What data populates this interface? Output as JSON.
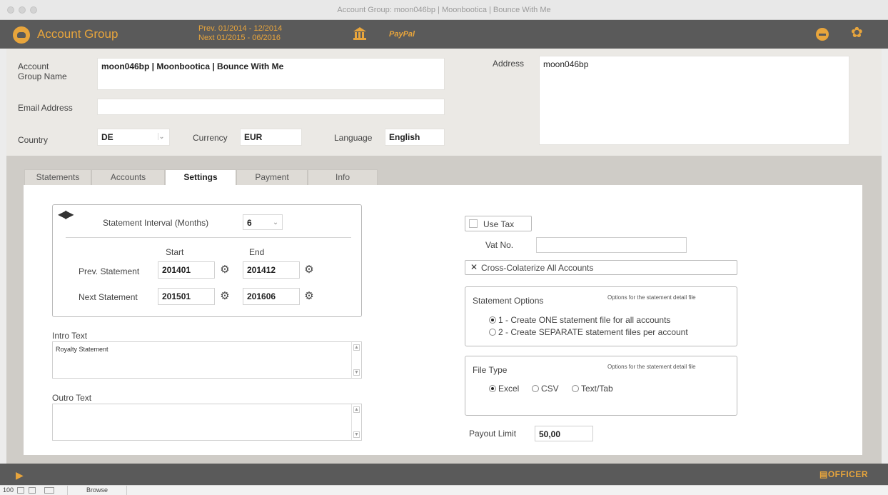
{
  "window": {
    "title": "Account Group: moon046bp | Moonbootica | Bounce With Me"
  },
  "header": {
    "title": "Account Group",
    "prev_period": "Prev. 01/2014 - 12/2014",
    "next_period": "Next  01/2015 - 06/2016",
    "paypal_label": "PayPal",
    "brand_color": "#e8a53c",
    "icons": [
      "account-group-icon",
      "bank-icon",
      "minus-circle-icon",
      "paw-icon"
    ]
  },
  "form": {
    "name_label": "Account Group Name",
    "name_value": "moon046bp | Moonbootica | Bounce With Me",
    "email_label": "Email Address",
    "email_value": "",
    "country_label": "Country",
    "country_value": "DE",
    "currency_label": "Currency",
    "currency_value": "EUR",
    "language_label": "Language",
    "language_value": "English",
    "address_label": "Address",
    "address_value": "moon046bp"
  },
  "tabs": [
    {
      "label": "Statements"
    },
    {
      "label": "Accounts"
    },
    {
      "label": "Settings",
      "active": true
    },
    {
      "label": "Payment"
    },
    {
      "label": "Info"
    }
  ],
  "settings": {
    "interval_label": "Statement Interval (Months)",
    "interval_value": "6",
    "start_header": "Start",
    "end_header": "End",
    "prev_label": "Prev. Statement",
    "prev_start": "201401",
    "prev_end": "201412",
    "next_label": "Next Statement",
    "next_start": "201501",
    "next_end": "201606",
    "intro_label": "Intro Text",
    "intro_value": "Royalty Statement",
    "outro_label": "Outro Text",
    "outro_value": "",
    "use_tax_label": "Use Tax",
    "use_tax_checked": false,
    "vat_label": "Vat No.",
    "vat_value": "",
    "cross_label": "Cross-Colaterize All Accounts",
    "cross_checked": true,
    "statement_options_title": "Statement Options",
    "options_hint": "Options for the statement detail file",
    "option_one": "1 - Create ONE statement file for all accounts",
    "option_separate": "2 - Create SEPARATE statement files per account",
    "file_type_title": "File Type",
    "file_type_hint": "Options for the statement detail file",
    "file_excel": "Excel",
    "file_csv": "CSV",
    "file_text": "Text/Tab",
    "file_type_selected": "Excel",
    "payout_label": "Payout Limit",
    "payout_value": "50,00"
  },
  "footer": {
    "brand": "OFFICER"
  },
  "status": {
    "zoom": "100",
    "mode": "Browse"
  }
}
